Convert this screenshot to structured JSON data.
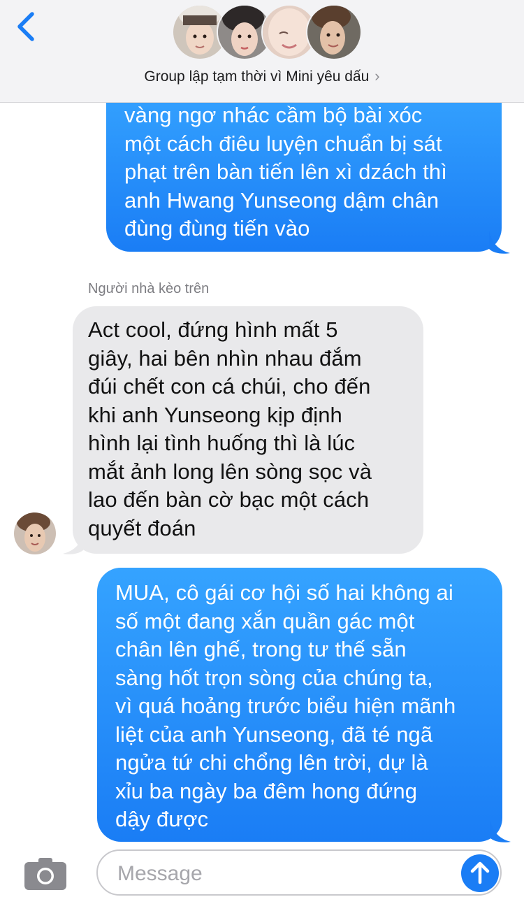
{
  "header": {
    "group_title": "Group lập tạm thời vì Mini yêu dấu",
    "back_icon": "chevron-left-icon",
    "disclosure_icon": "chevron-right-icon",
    "accent_color": "#1a7df5"
  },
  "messages": [
    {
      "direction": "sent",
      "lines": [
        "vàng ngơ nhác cầm bộ bài xóc",
        "một cách điêu luyện chuẩn bị sát",
        "phạt trên bàn tiến lên xì dzách thì",
        "anh Hwang Yunseong dậm chân",
        "đùng đùng tiến vào"
      ]
    },
    {
      "direction": "received",
      "sender": "Người nhà kèo trên",
      "lines": [
        "Act cool, đứng hình mất 5",
        "giây, hai bên nhìn nhau đắm",
        "đúi chết con cá chúi, cho đến",
        "khi anh Yunseong kịp định",
        "hình lại tình huống thì là lúc",
        "mắt ảnh long lên sòng sọc và",
        "lao đến bàn cờ bạc một cách",
        "quyết đoán"
      ]
    },
    {
      "direction": "sent",
      "lines": [
        "MUA, cô gái cơ hội số hai không ai",
        "số một đang xắn quần gác một",
        "chân lên ghế, trong tư thế sẵn",
        "sàng hốt trọn sòng của chúng ta,",
        "vì quá hoảng trước biểu hiện mãnh",
        "liệt của anh Yunseong, đã té ngã",
        "ngửa tứ chi chổng lên trời, dự là",
        "xỉu ba ngày ba đêm hong đứng",
        "dậy được"
      ]
    }
  ],
  "composer": {
    "placeholder": "Message",
    "camera_icon": "camera-icon",
    "send_icon": "arrow-up-icon"
  }
}
